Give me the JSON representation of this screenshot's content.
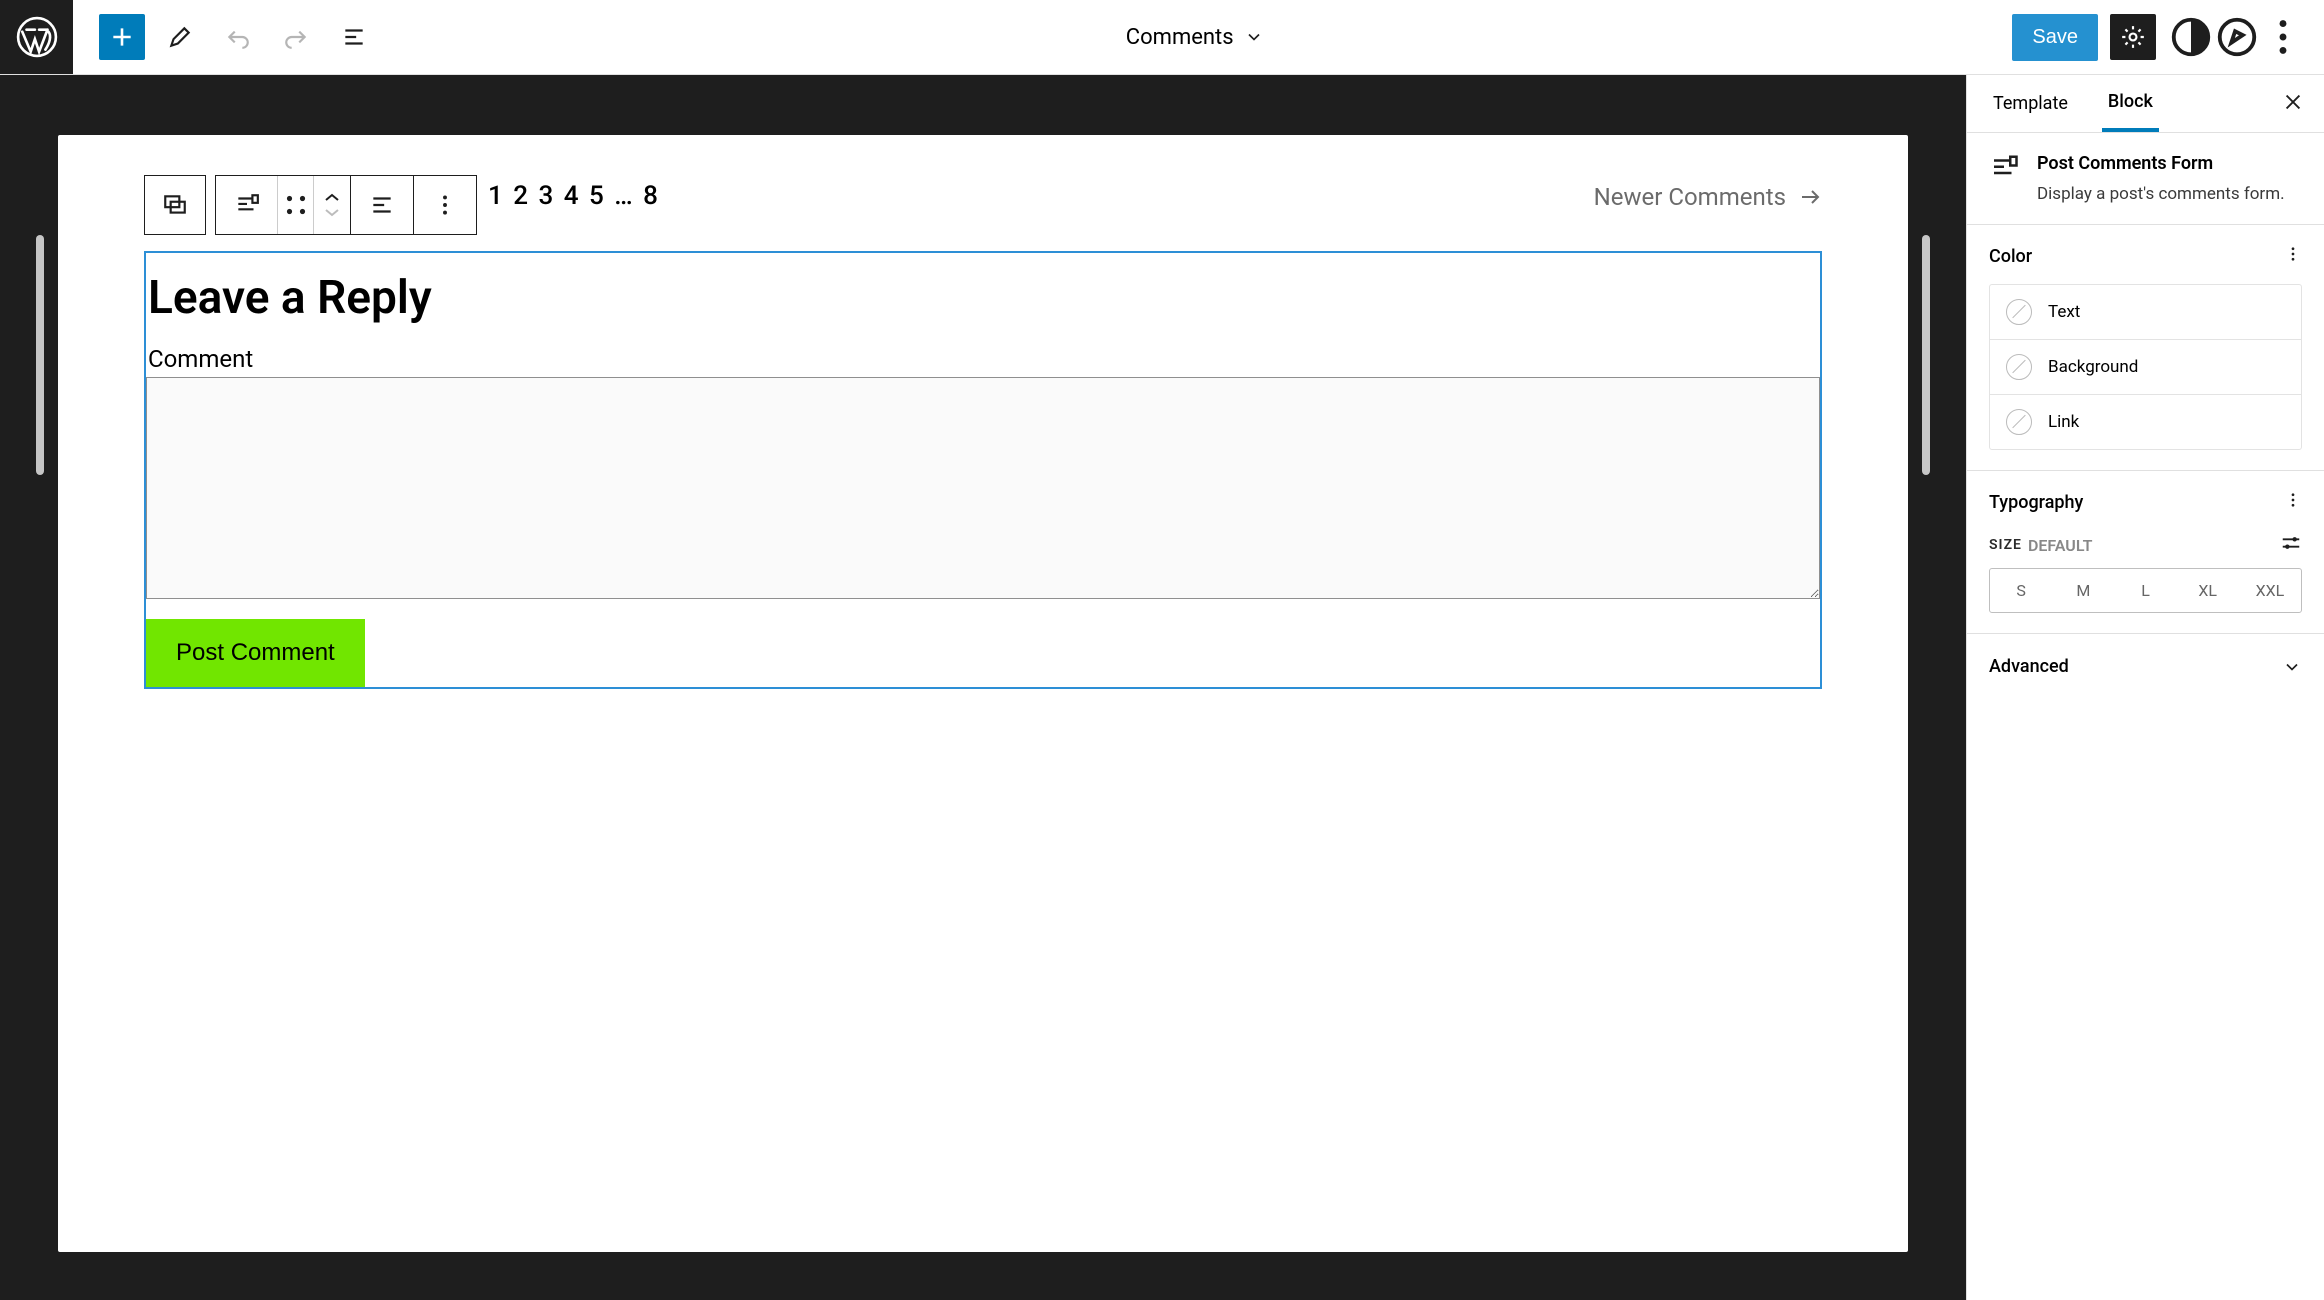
{
  "topbar": {
    "document_title": "Comments",
    "save_label": "Save"
  },
  "canvas": {
    "pagination": "1 2 3 4 5 … 8",
    "newer_comments_label": "Newer Comments",
    "reply_title": "Leave a Reply",
    "comment_field_label": "Comment",
    "submit_label": "Post Comment"
  },
  "sidebar": {
    "tabs": {
      "template": "Template",
      "block": "Block"
    },
    "block_info": {
      "title": "Post Comments Form",
      "description": "Display a post's comments form."
    },
    "color": {
      "heading": "Color",
      "rows": {
        "text": "Text",
        "background": "Background",
        "link": "Link"
      }
    },
    "typography": {
      "heading": "Typography",
      "size_label": "SIZE",
      "size_default": "DEFAULT",
      "sizes": {
        "s": "S",
        "m": "M",
        "l": "L",
        "xl": "XL",
        "xxl": "XXL"
      }
    },
    "advanced_label": "Advanced"
  }
}
